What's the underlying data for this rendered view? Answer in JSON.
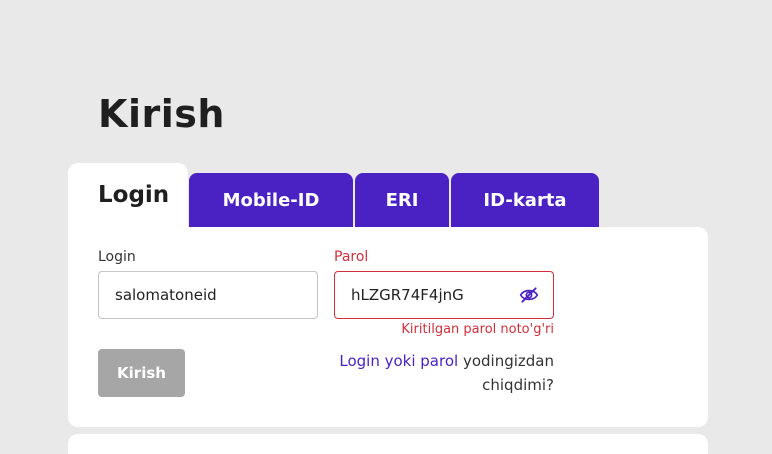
{
  "page": {
    "title": "Kirish"
  },
  "tabs": [
    {
      "label": "Login",
      "active": true
    },
    {
      "label": "Mobile-ID",
      "active": false
    },
    {
      "label": "ERI",
      "active": false
    },
    {
      "label": "ID-karta",
      "active": false
    }
  ],
  "form": {
    "login_label": "Login",
    "login_value": "salomatoneid",
    "password_label": "Parol",
    "password_value": "hLZGR74F4jnG",
    "password_error": "Kiritilgan parol noto'g'ri",
    "submit_label": "Kirish",
    "forgot_link": "Login yoki parol",
    "forgot_rest": "yodingizdan chiqdimi?"
  },
  "icons": {
    "password_visibility": "eye-slash-icon"
  },
  "colors": {
    "accent": "#4a22c4",
    "error": "#d32f3a",
    "disabled_button": "#a6a6a6",
    "background": "#e9e9e9"
  }
}
